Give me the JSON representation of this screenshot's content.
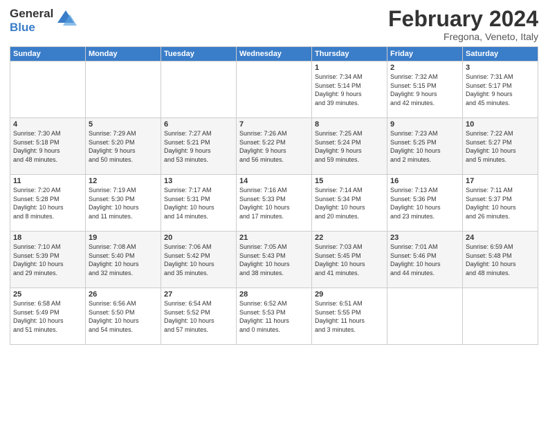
{
  "header": {
    "logo_line1": "General",
    "logo_line2": "Blue",
    "title": "February 2024",
    "subtitle": "Fregona, Veneto, Italy"
  },
  "calendar": {
    "headers": [
      "Sunday",
      "Monday",
      "Tuesday",
      "Wednesday",
      "Thursday",
      "Friday",
      "Saturday"
    ],
    "weeks": [
      [
        {
          "day": "",
          "info": ""
        },
        {
          "day": "",
          "info": ""
        },
        {
          "day": "",
          "info": ""
        },
        {
          "day": "",
          "info": ""
        },
        {
          "day": "1",
          "info": "Sunrise: 7:34 AM\nSunset: 5:14 PM\nDaylight: 9 hours\nand 39 minutes."
        },
        {
          "day": "2",
          "info": "Sunrise: 7:32 AM\nSunset: 5:15 PM\nDaylight: 9 hours\nand 42 minutes."
        },
        {
          "day": "3",
          "info": "Sunrise: 7:31 AM\nSunset: 5:17 PM\nDaylight: 9 hours\nand 45 minutes."
        }
      ],
      [
        {
          "day": "4",
          "info": "Sunrise: 7:30 AM\nSunset: 5:18 PM\nDaylight: 9 hours\nand 48 minutes."
        },
        {
          "day": "5",
          "info": "Sunrise: 7:29 AM\nSunset: 5:20 PM\nDaylight: 9 hours\nand 50 minutes."
        },
        {
          "day": "6",
          "info": "Sunrise: 7:27 AM\nSunset: 5:21 PM\nDaylight: 9 hours\nand 53 minutes."
        },
        {
          "day": "7",
          "info": "Sunrise: 7:26 AM\nSunset: 5:22 PM\nDaylight: 9 hours\nand 56 minutes."
        },
        {
          "day": "8",
          "info": "Sunrise: 7:25 AM\nSunset: 5:24 PM\nDaylight: 9 hours\nand 59 minutes."
        },
        {
          "day": "9",
          "info": "Sunrise: 7:23 AM\nSunset: 5:25 PM\nDaylight: 10 hours\nand 2 minutes."
        },
        {
          "day": "10",
          "info": "Sunrise: 7:22 AM\nSunset: 5:27 PM\nDaylight: 10 hours\nand 5 minutes."
        }
      ],
      [
        {
          "day": "11",
          "info": "Sunrise: 7:20 AM\nSunset: 5:28 PM\nDaylight: 10 hours\nand 8 minutes."
        },
        {
          "day": "12",
          "info": "Sunrise: 7:19 AM\nSunset: 5:30 PM\nDaylight: 10 hours\nand 11 minutes."
        },
        {
          "day": "13",
          "info": "Sunrise: 7:17 AM\nSunset: 5:31 PM\nDaylight: 10 hours\nand 14 minutes."
        },
        {
          "day": "14",
          "info": "Sunrise: 7:16 AM\nSunset: 5:33 PM\nDaylight: 10 hours\nand 17 minutes."
        },
        {
          "day": "15",
          "info": "Sunrise: 7:14 AM\nSunset: 5:34 PM\nDaylight: 10 hours\nand 20 minutes."
        },
        {
          "day": "16",
          "info": "Sunrise: 7:13 AM\nSunset: 5:36 PM\nDaylight: 10 hours\nand 23 minutes."
        },
        {
          "day": "17",
          "info": "Sunrise: 7:11 AM\nSunset: 5:37 PM\nDaylight: 10 hours\nand 26 minutes."
        }
      ],
      [
        {
          "day": "18",
          "info": "Sunrise: 7:10 AM\nSunset: 5:39 PM\nDaylight: 10 hours\nand 29 minutes."
        },
        {
          "day": "19",
          "info": "Sunrise: 7:08 AM\nSunset: 5:40 PM\nDaylight: 10 hours\nand 32 minutes."
        },
        {
          "day": "20",
          "info": "Sunrise: 7:06 AM\nSunset: 5:42 PM\nDaylight: 10 hours\nand 35 minutes."
        },
        {
          "day": "21",
          "info": "Sunrise: 7:05 AM\nSunset: 5:43 PM\nDaylight: 10 hours\nand 38 minutes."
        },
        {
          "day": "22",
          "info": "Sunrise: 7:03 AM\nSunset: 5:45 PM\nDaylight: 10 hours\nand 41 minutes."
        },
        {
          "day": "23",
          "info": "Sunrise: 7:01 AM\nSunset: 5:46 PM\nDaylight: 10 hours\nand 44 minutes."
        },
        {
          "day": "24",
          "info": "Sunrise: 6:59 AM\nSunset: 5:48 PM\nDaylight: 10 hours\nand 48 minutes."
        }
      ],
      [
        {
          "day": "25",
          "info": "Sunrise: 6:58 AM\nSunset: 5:49 PM\nDaylight: 10 hours\nand 51 minutes."
        },
        {
          "day": "26",
          "info": "Sunrise: 6:56 AM\nSunset: 5:50 PM\nDaylight: 10 hours\nand 54 minutes."
        },
        {
          "day": "27",
          "info": "Sunrise: 6:54 AM\nSunset: 5:52 PM\nDaylight: 10 hours\nand 57 minutes."
        },
        {
          "day": "28",
          "info": "Sunrise: 6:52 AM\nSunset: 5:53 PM\nDaylight: 11 hours\nand 0 minutes."
        },
        {
          "day": "29",
          "info": "Sunrise: 6:51 AM\nSunset: 5:55 PM\nDaylight: 11 hours\nand 3 minutes."
        },
        {
          "day": "",
          "info": ""
        },
        {
          "day": "",
          "info": ""
        }
      ]
    ]
  }
}
